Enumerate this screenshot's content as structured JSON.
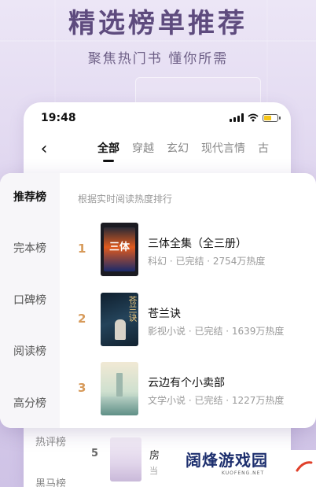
{
  "promo": {
    "headline": "精选榜单推荐",
    "subhead": "聚焦热门书 懂你所需"
  },
  "status_bar": {
    "time": "19:48",
    "battery_level": 0.55
  },
  "nav": {
    "tabs": [
      "全部",
      "穿越",
      "玄幻",
      "现代言情",
      "古"
    ],
    "active_tab": "全部"
  },
  "card": {
    "header": "根据实时阅读热度排行",
    "sidebar": [
      "推荐榜",
      "完本榜",
      "口碑榜",
      "阅读榜",
      "高分榜"
    ],
    "active_sidebar": "推荐榜",
    "books": [
      {
        "rank": "1",
        "title": "三体全集（全三册）",
        "meta": "科幻 · 已完结 · 2754万热度",
        "cover_text": "三体"
      },
      {
        "rank": "2",
        "title": "苍兰诀",
        "meta": "影视小说 · 已完结 · 1639万热度",
        "cover_text": "苍兰诀"
      },
      {
        "rank": "3",
        "title": "云边有个小卖部",
        "meta": "文学小说 · 已完结 · 1227万热度",
        "cover_text": ""
      }
    ]
  },
  "peek": {
    "sidebar": [
      "热评榜",
      "黑马榜"
    ],
    "row": {
      "rank": "5",
      "title": "房",
      "sub": "当"
    }
  },
  "watermark": {
    "text": "阔烽游戏园",
    "url": "KUOFENG.NET"
  },
  "colors": {
    "accent_rank": "#d79a5a",
    "headline": "#5e4b7e",
    "background": "#ddd3ee"
  }
}
